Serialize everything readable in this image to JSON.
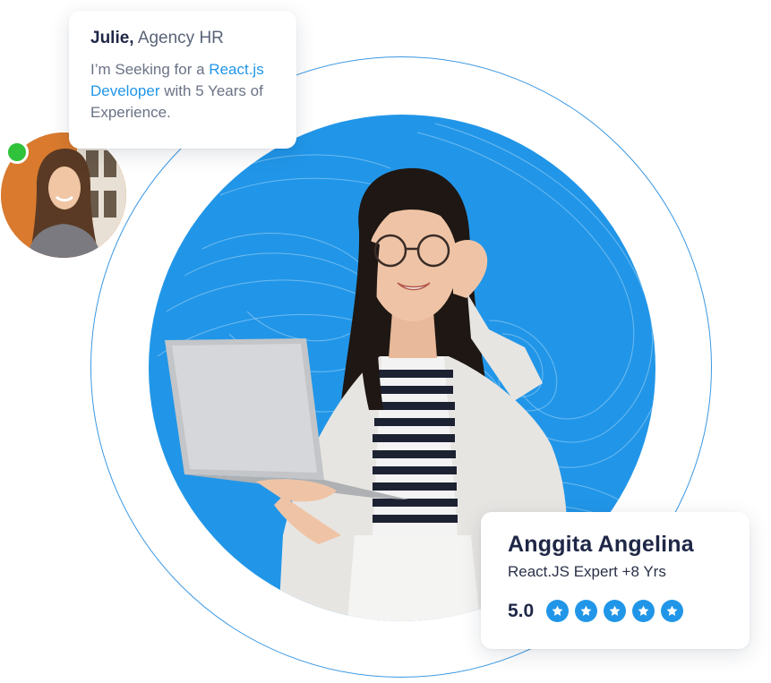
{
  "request_card": {
    "name": "Julie,",
    "role": "Agency HR",
    "message_before": "I’m Seeking for a",
    "message_highlight": "React.js Developer",
    "message_after": "with 5 Years of Experience."
  },
  "profile_card": {
    "name": "Anggita Angelina",
    "subtitle": "React.JS Expert +8 Yrs",
    "rating": "5.0",
    "stars": 5
  },
  "colors": {
    "accent": "#2196e8",
    "online": "#2fc23a",
    "heading": "#1f2747"
  },
  "icons": [
    "star-icon",
    "online-status-icon"
  ]
}
